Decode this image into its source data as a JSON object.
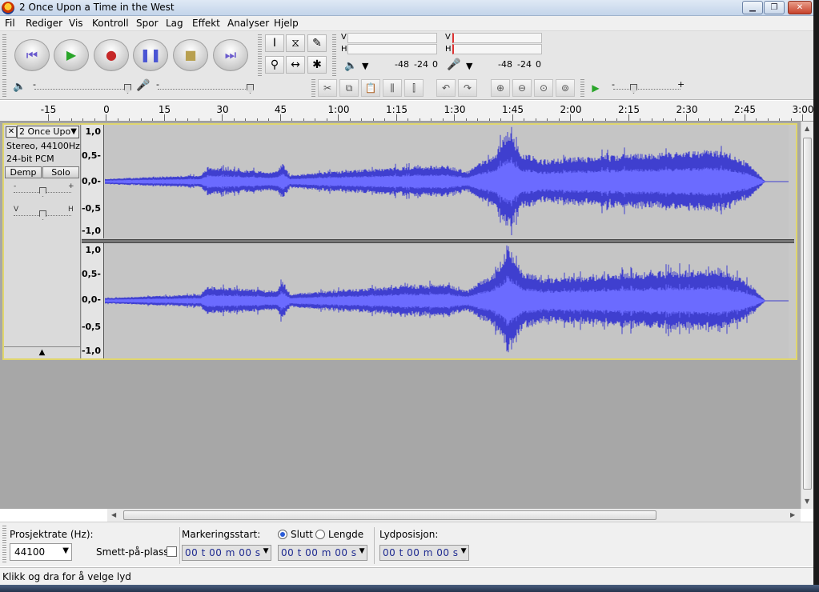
{
  "window": {
    "title": "2 Once Upon a Time in the West",
    "min_glyph": "▁",
    "max_glyph": "❐",
    "close_glyph": "✕"
  },
  "menu": [
    "Fil",
    "Rediger",
    "Vis",
    "Kontroll",
    "Spor",
    "Lag",
    "Effekt",
    "Analyser",
    "Hjelp"
  ],
  "meters": {
    "play_left": "V",
    "play_right": "H",
    "rec_left": "V",
    "rec_right": "H",
    "play_scale": [
      "-48",
      "-24",
      "0"
    ],
    "rec_scale": [
      "-48",
      "-24",
      "0"
    ]
  },
  "ruler": {
    "labels": [
      "-15",
      "0",
      "15",
      "30",
      "45",
      "1:00",
      "1:15",
      "1:30",
      "1:45",
      "2:00",
      "2:15",
      "2:30",
      "2:45",
      "3:00"
    ]
  },
  "track": {
    "name": "2 Once Upo",
    "info_line1": "Stereo, 44100Hz",
    "info_line2": "24-bit PCM",
    "mute_label": "Demp",
    "solo_label": "Solo",
    "gain_minus": "-",
    "gain_plus": "+",
    "pan_left": "V",
    "pan_right": "H",
    "y_labels": [
      "1,0",
      "0,5-",
      "0,0-",
      "-0,5",
      "-1,0"
    ],
    "wave_color": "#3f3fcf",
    "wave_rms_color": "#6b6bff"
  },
  "selection_bar": {
    "rate_label": "Prosjektrate (Hz):",
    "rate_value": "44100",
    "snap_label": "Smett-på-plass",
    "start_label": "Markeringsstart:",
    "end_label": "Slutt",
    "length_label": "Lengde",
    "pos_label": "Lydposisjon:",
    "start_value": "00 t 00 m 00 s",
    "end_value": "00 t 00 m 00 s",
    "pos_value": "00 t 00 m 00 s"
  },
  "status": "Klikk og dra for å velge lyd"
}
